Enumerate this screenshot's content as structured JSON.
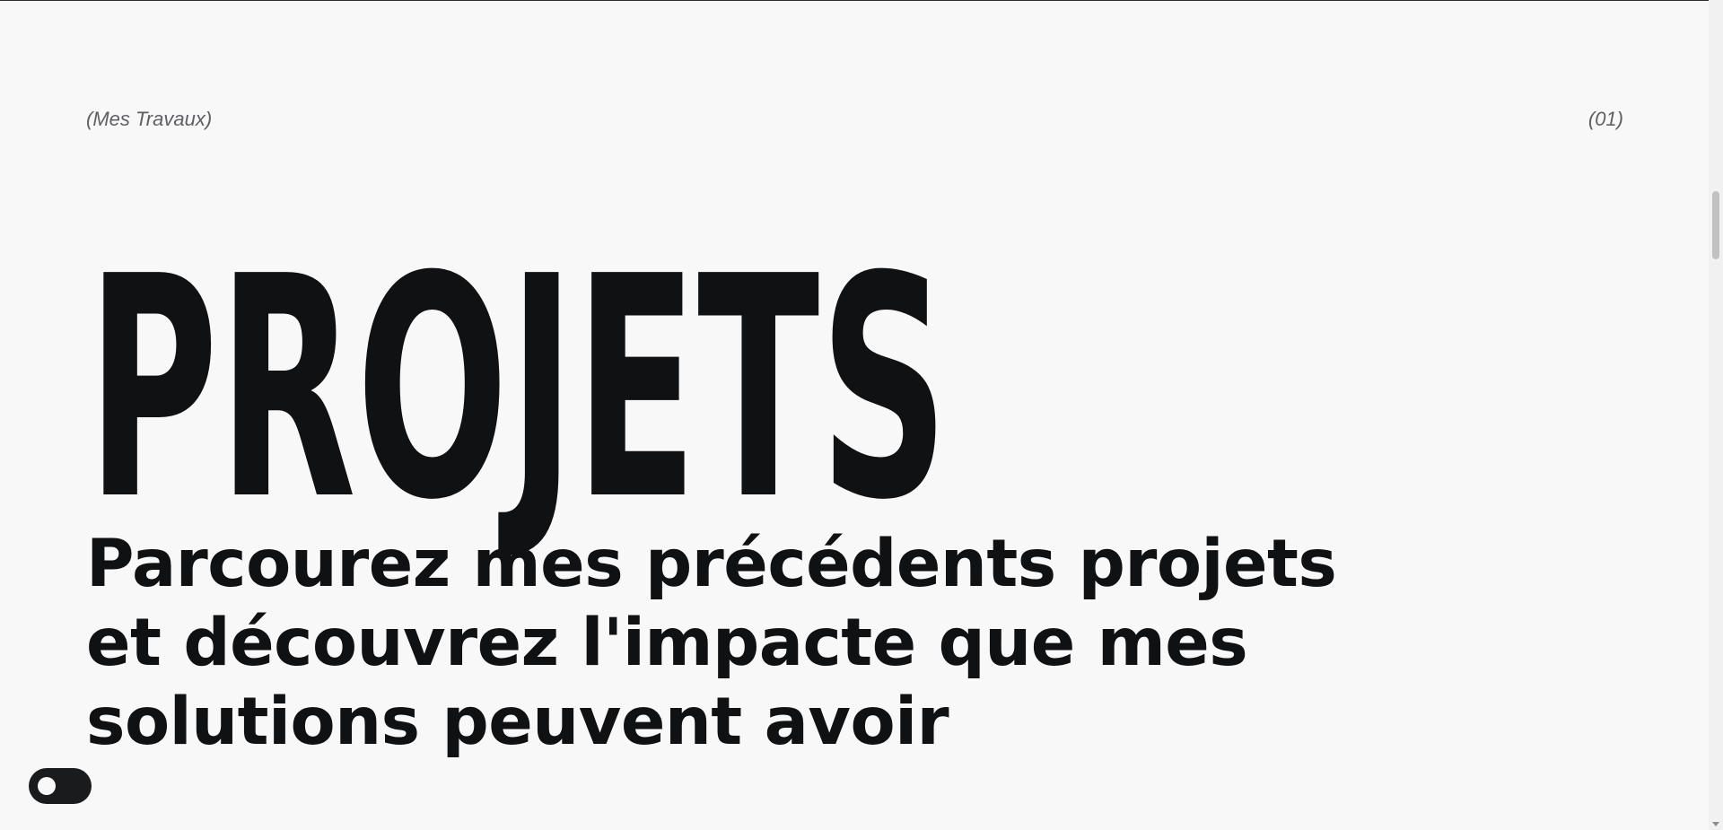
{
  "section": {
    "label": "(Mes Travaux)",
    "index": "(01)"
  },
  "hero": {
    "title": "PROJETS",
    "subtitle_lines": [
      "Parcourez mes précédents projets",
      "et découvrez l'impacte que mes",
      "solutions peuvent avoir"
    ]
  },
  "icons": {
    "theme_toggle": "toggle-switch-icon"
  },
  "colors": {
    "background": "#f8f8f8",
    "text": "#101113",
    "muted": "#5f6063",
    "toggle": "#1a1b1d"
  }
}
